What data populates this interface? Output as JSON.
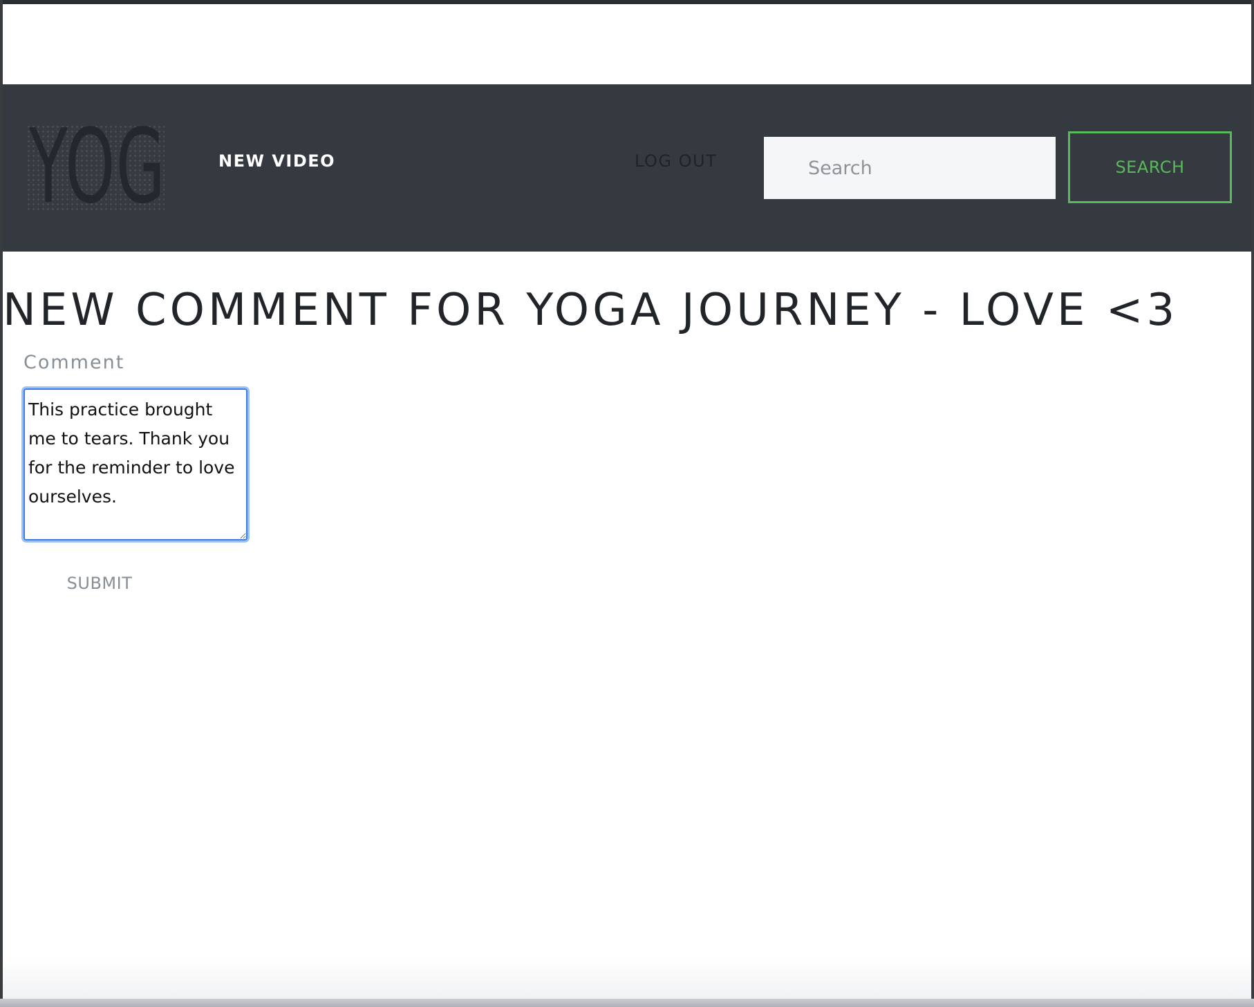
{
  "navbar": {
    "logo_text": "YOG",
    "links": {
      "new_video": "NEW VIDEO",
      "log_out": "LOG OUT"
    },
    "search": {
      "placeholder": "Search",
      "value": "",
      "button_label": "SEARCH"
    }
  },
  "main": {
    "title": "NEW COMMENT FOR YOGA JOURNEY - LOVE <3",
    "form": {
      "comment_label": "Comment",
      "comment_value": "This practice brought me to tears. Thank you for the reminder to love ourselves.",
      "submit_label": "SUBMIT"
    }
  },
  "colors": {
    "navbar_bg": "#343a40",
    "search_accent": "#5cb85c",
    "focus_ring": "#3b7fe6",
    "muted_text": "#868e96",
    "title_text": "#212529"
  }
}
